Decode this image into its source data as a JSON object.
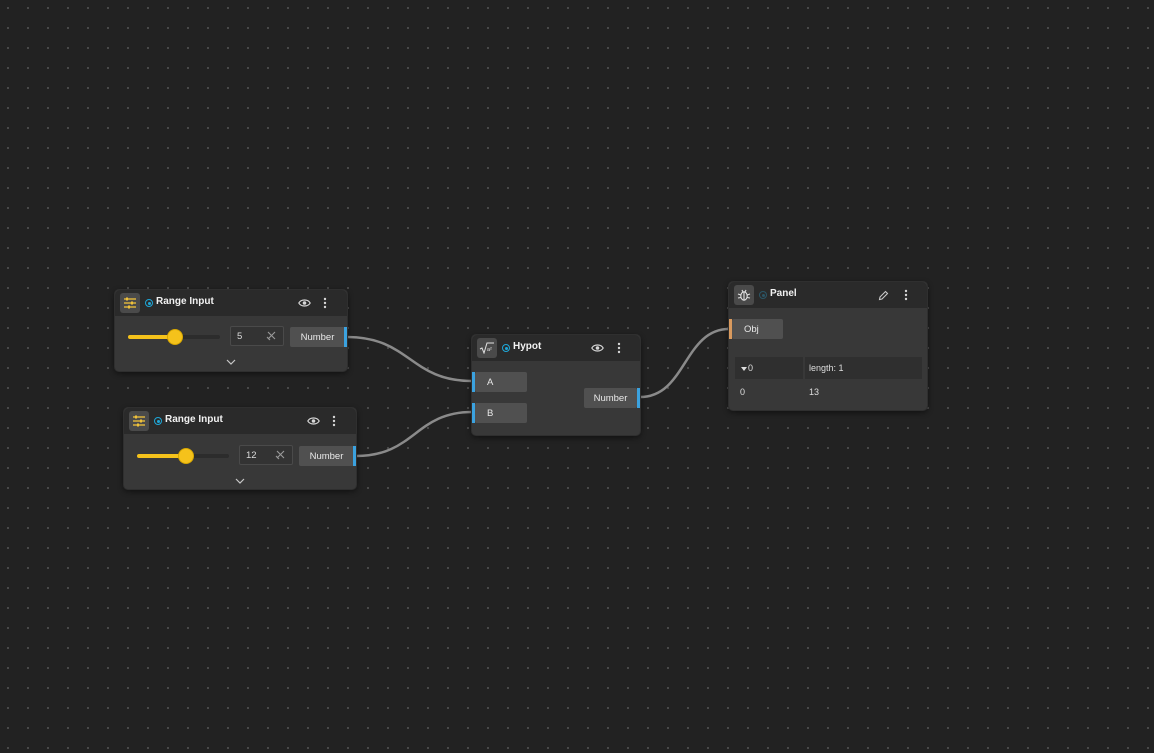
{
  "nodes": {
    "range1": {
      "title": "Range Input",
      "value": "5",
      "output_label": "Number",
      "slider_fraction": 0.5
    },
    "range2": {
      "title": "Range Input",
      "value": "12",
      "output_label": "Number",
      "slider_fraction": 0.55
    },
    "hypot": {
      "title": "Hypot",
      "input_a": "A",
      "input_b": "B",
      "output_label": "Number"
    },
    "panel": {
      "title": "Panel",
      "input_label": "Obj",
      "rows": [
        {
          "key": "0",
          "value": "length: 1",
          "expanded": true
        },
        {
          "key": "0",
          "value": "13"
        }
      ]
    }
  },
  "colors": {
    "accent": "#f5c21b",
    "port_blue": "#3ba2df",
    "port_orange": "#d99a5e",
    "status": "#1ea7d8",
    "wire": "#8a8a8a"
  },
  "icons": {
    "range": "sliders-icon",
    "hypot": "sqrt-formula-icon",
    "panel": "bug-icon",
    "visibility": "eye-icon",
    "menu": "more-vertical-icon",
    "clear": "clear-x-icon",
    "expand": "chevron-down-icon",
    "edit": "pencil-icon"
  }
}
